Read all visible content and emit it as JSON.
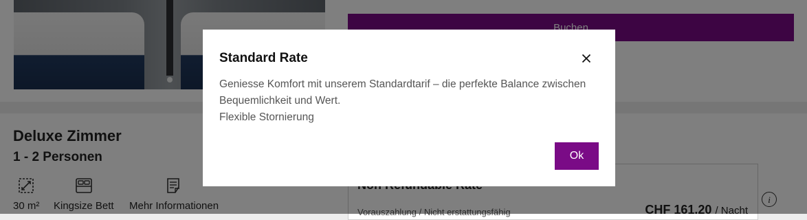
{
  "background": {
    "book_button": "Buchen",
    "room": {
      "title": "Deluxe Zimmer",
      "persons": "1 - 2 Personen",
      "features": {
        "size": "30 m²",
        "bed": "Kingsize Bett",
        "info": "Mehr Informationen"
      }
    },
    "rate": {
      "title": "Non Refundable Rate",
      "subtitle": "Vorauszahlung / Nicht erstattungsfähig",
      "price": "CHF 161.20",
      "per": "/ Nacht"
    },
    "info_glyph": "i"
  },
  "modal": {
    "title": "Standard Rate",
    "close_glyph": "✕",
    "body_line1": "Geniesse Komfort mit unserem Standardtarif – die perfekte Balance zwischen Bequemlichkeit und Wert.",
    "body_line2": "Flexible Stornierung",
    "ok_label": "Ok"
  },
  "colors": {
    "accent": "#7a0b86",
    "overlay": "rgba(0,0,0,0.5)"
  },
  "icons": [
    "size-icon",
    "bed-icon",
    "info-list-icon",
    "info-circle-icon",
    "close-icon"
  ]
}
